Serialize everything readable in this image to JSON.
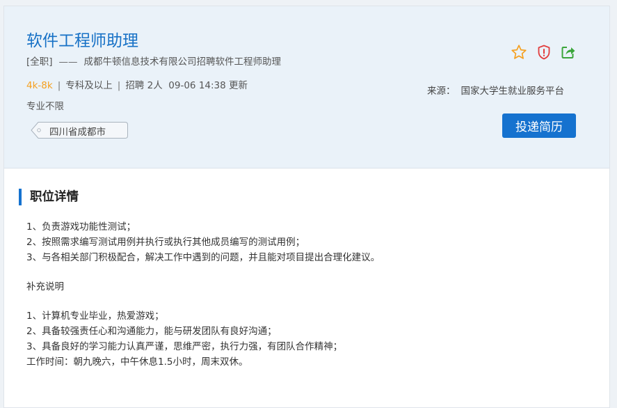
{
  "job": {
    "title": "软件工程师助理",
    "type": "[全职]",
    "dash": "——",
    "company_line": "成都牛顿信息技术有限公司招聘软件工程师助理",
    "salary": "4k-8k",
    "education": "专科及以上",
    "recruit": "招聘 2人",
    "updated": "09-06 14:38 更新",
    "major": "专业不限",
    "location": "四川省成都市",
    "separator": "|"
  },
  "source": {
    "label": "来源：",
    "value": "国家大学生就业服务平台"
  },
  "actions": {
    "apply_label": "投递简历",
    "favorite_icon": "star-icon",
    "report_icon": "shield-alert-icon",
    "share_icon": "share-icon",
    "colors": {
      "star": "#f5a020",
      "report": "#e23c3c",
      "share": "#3aa53a",
      "button": "#1572cf"
    }
  },
  "details": {
    "heading": "职位详情",
    "duties": [
      "1、负责游戏功能性测试；",
      "2、按照需求编写测试用例并执行或执行其他成员编写的测试用例；",
      "3、与各相关部门积极配合，解决工作中遇到的问题，并且能对项目提出合理化建议。"
    ],
    "supplement_title": "补充说明",
    "requirements": [
      "1、计算机专业毕业，热爱游戏；",
      "2、具备较强责任心和沟通能力，能与研发团队有良好沟通；",
      "3、具备良好的学习能力认真严谨，思维严密，执行力强，有团队合作精神；",
      "工作时间：朝九晚六，中午休息1.5小时，周末双休。"
    ]
  }
}
